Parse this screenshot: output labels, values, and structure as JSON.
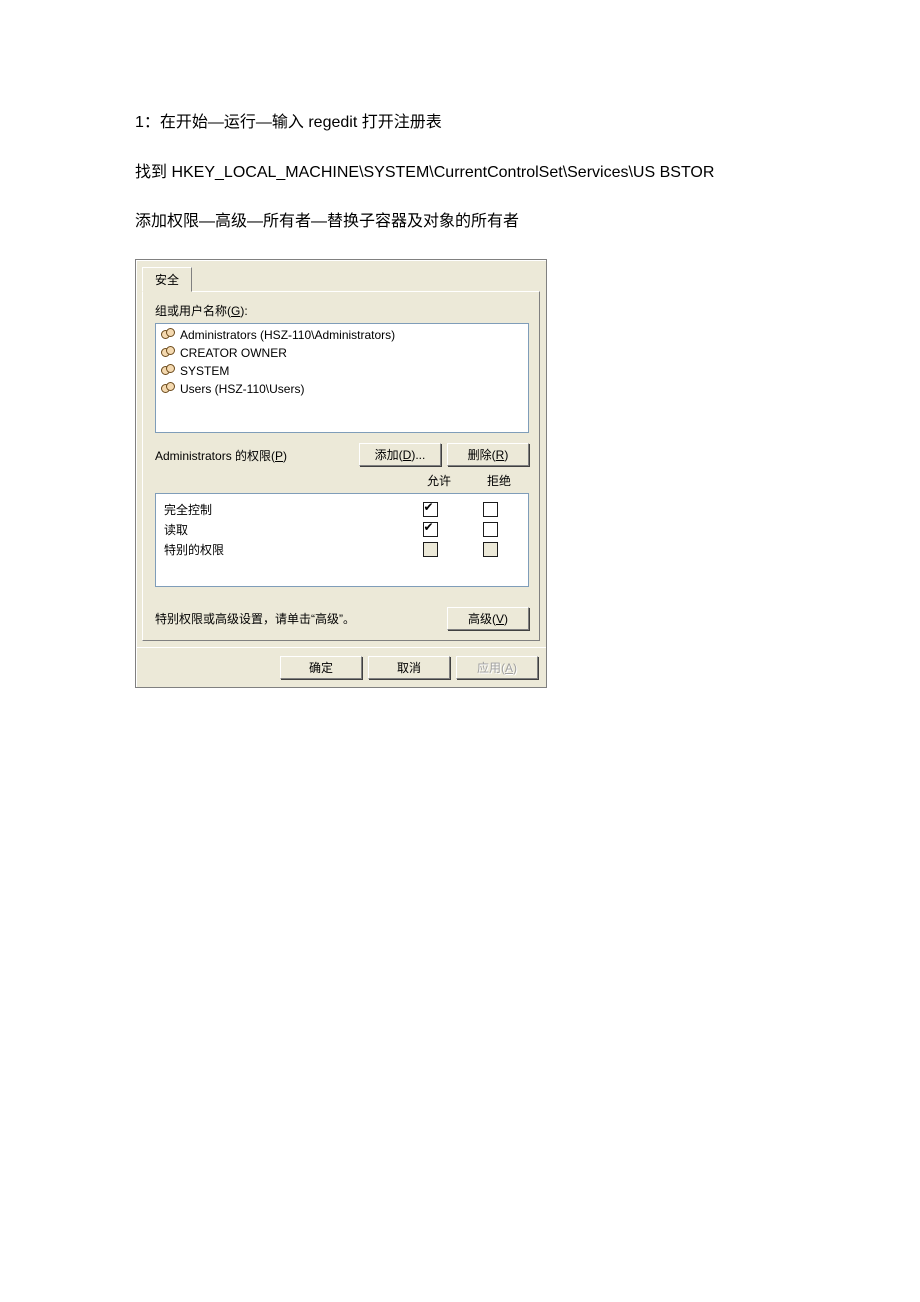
{
  "doc": {
    "p1": "1：在开始—运行—输入 regedit 打开注册表",
    "p2": "找到 HKEY_LOCAL_MACHINE\\SYSTEM\\CurrentControlSet\\Services\\US BSTOR",
    "p3": "添加权限—高级—所有者—替换子容器及对象的所有者"
  },
  "dialog": {
    "tab": "安全",
    "groups_label_pre": "组或用户名称(",
    "groups_label_u": "G",
    "groups_label_post": "):",
    "groups": [
      "Administrators (HSZ-110\\Administrators)",
      "CREATOR OWNER",
      "SYSTEM",
      "Users (HSZ-110\\Users)"
    ],
    "perm_for_pre": "Administrators 的权限(",
    "perm_for_u": "P",
    "perm_for_post": ")",
    "add_pre": "添加(",
    "add_u": "D",
    "add_post": ")...",
    "remove_pre": "删除(",
    "remove_u": "R",
    "remove_post": ")",
    "col_allow": "允许",
    "col_deny": "拒绝",
    "perms": [
      {
        "name": "完全控制",
        "allow": true,
        "deny": false,
        "disabled": false
      },
      {
        "name": "读取",
        "allow": true,
        "deny": false,
        "disabled": false
      },
      {
        "name": "特别的权限",
        "allow": false,
        "deny": false,
        "disabled": true
      }
    ],
    "adv_text": "特别权限或高级设置，请单击“高级”。",
    "adv_btn_pre": "高级(",
    "adv_btn_u": "V",
    "adv_btn_post": ")",
    "ok": "确定",
    "cancel": "取消",
    "apply_pre": "应用(",
    "apply_u": "A",
    "apply_post": ")"
  }
}
